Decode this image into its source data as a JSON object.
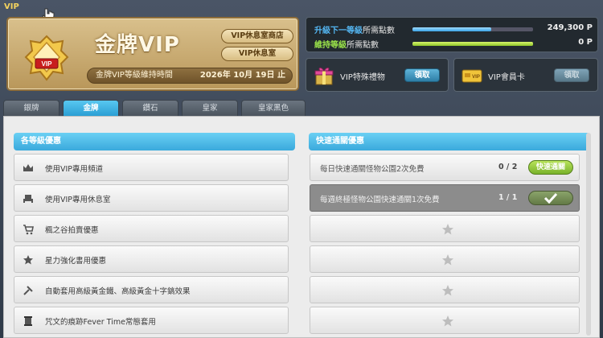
{
  "window": {
    "title": "VIP"
  },
  "tier_card": {
    "tier_name": "金牌VIP",
    "shop_button": "VIP休息室商店",
    "lounge_button": "VIP休息室",
    "maintain_label": "金牌VIP等級維持時間",
    "maintain_date": "2026年 10月 19日 止"
  },
  "points": {
    "upgrade_highlight": "升級下一等級",
    "upgrade_rest": "所需點數",
    "upgrade_value": "249,300 P",
    "upgrade_progress": 0.65,
    "maintain_highlight": "維持等級",
    "maintain_rest": "所需點數",
    "maintain_value": "0 P",
    "maintain_progress": 1.0
  },
  "gift": {
    "label": "VIP特殊禮物",
    "claim": "領取"
  },
  "card": {
    "label": "VIP會員卡",
    "claim": "領取"
  },
  "tabs": [
    {
      "label": "銀牌"
    },
    {
      "label": "金牌"
    },
    {
      "label": "鑽石"
    },
    {
      "label": "皇家"
    },
    {
      "label": "皇家黑色"
    }
  ],
  "benefits": {
    "title": "各等級優惠",
    "items": [
      {
        "text": "使用VIP專用頻道",
        "icon": "crown-icon"
      },
      {
        "text": "使用VIP專用休息室",
        "icon": "chair-icon"
      },
      {
        "text": "楓之谷拍賣優惠",
        "icon": "cart-icon"
      },
      {
        "text": "星力強化書用優惠",
        "icon": "star-icon"
      },
      {
        "text": "自動套用高級黃金鐵、高級黃金十字鎬效果",
        "icon": "pickaxe-icon"
      },
      {
        "text": "咒文的痕跡Fever Time常態套用",
        "icon": "scroll-icon"
      }
    ]
  },
  "quick_pass": {
    "title": "快速通關優惠",
    "items": [
      {
        "text": "每日快速通關怪物公園2次免費",
        "count": "0 / 2",
        "button": "快速通關"
      },
      {
        "text": "每週終極怪物公園快速通關1次免費",
        "count": "1 / 1"
      }
    ]
  },
  "colors": {
    "accent": "#3aa9dc",
    "gold": "#c9a865",
    "green": "#8fc52a"
  }
}
